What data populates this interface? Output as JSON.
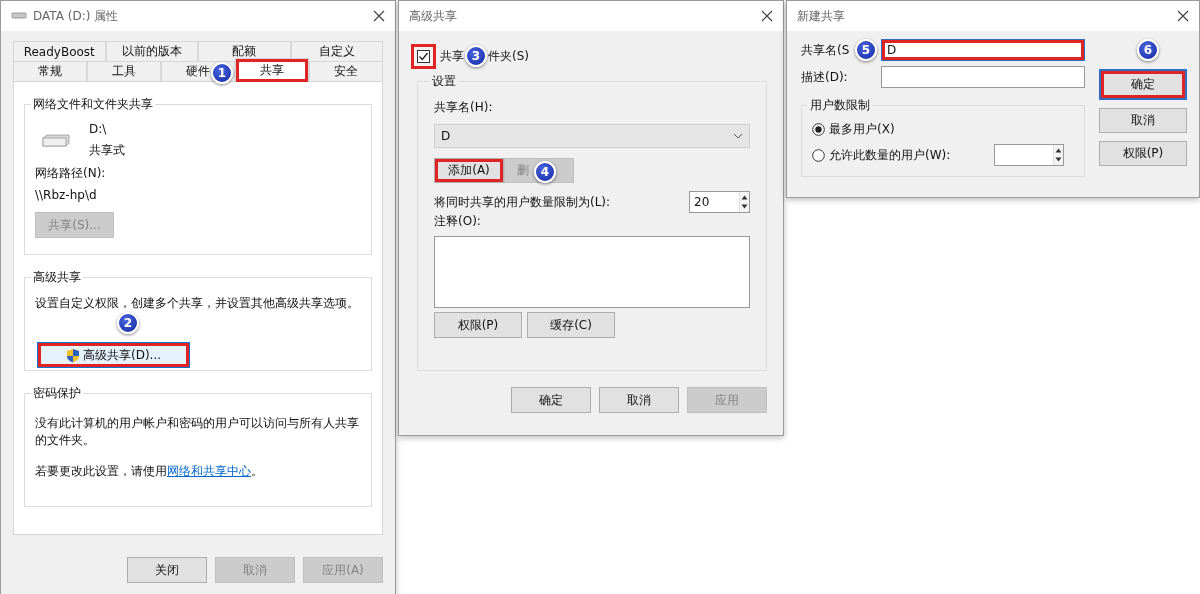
{
  "properties_window": {
    "title": "DATA (D:) 属性",
    "tab_rows": [
      [
        {
          "label": "ReadyBoost",
          "selected": false
        },
        {
          "label": "以前的版本",
          "selected": false
        },
        {
          "label": "配额",
          "selected": false
        },
        {
          "label": "自定义",
          "selected": false
        }
      ],
      [
        {
          "label": "常规",
          "selected": false
        },
        {
          "label": "工具",
          "selected": false
        },
        {
          "label": "硬件",
          "selected": false
        },
        {
          "label": "共享",
          "selected": true,
          "highlighted": true,
          "badge": "1"
        },
        {
          "label": "安全",
          "selected": false
        }
      ]
    ],
    "network_group": {
      "title": "网络文件和文件夹共享",
      "drive": "D:\\",
      "status": "共享式",
      "path_label": "网络路径(N):",
      "network_path": "\\\\Rbz-hp\\d",
      "share_button": {
        "label": "共享(S)...",
        "disabled": true
      }
    },
    "advanced_group": {
      "title": "高级共享",
      "description": "设置自定义权限，创建多个共享，并设置其他高级共享选项。",
      "button": {
        "label": "高级共享(D)...",
        "highlighted": true,
        "badge": "2"
      }
    },
    "password_group": {
      "title": "密码保护",
      "description": "没有此计算机的用户帐户和密码的用户可以访问与所有人共享的文件夹。",
      "hint": "若要更改此设置，请使用",
      "link": "网络和共享中心",
      "hint_end": "。"
    },
    "buttons": [
      {
        "label": "关闭",
        "disabled": false
      },
      {
        "label": "取消",
        "disabled": true
      },
      {
        "label": "应用(A)",
        "disabled": true
      }
    ]
  },
  "advanced_window": {
    "title": "高级共享",
    "share_checkbox": {
      "label_parts": [
        "共享",
        "件夹(S)"
      ],
      "checked": true,
      "highlighted": true,
      "badge": "3"
    },
    "settings_group": {
      "title": "设置",
      "share_name_label": "共享名(H):",
      "share_name": "D",
      "add_button": {
        "label": "添加(A)",
        "disabled": false,
        "highlighted": true
      },
      "remove_button": {
        "label": "删",
        "disabled": true,
        "badge": "4"
      },
      "limit_label": "将同时共享的用户数量限制为(L):",
      "limit_value": "20",
      "comment_label": "注释(O):",
      "buttons": [
        {
          "label": "权限(P)",
          "disabled": false
        },
        {
          "label": "缓存(C)",
          "disabled": false
        }
      ]
    },
    "buttons": [
      {
        "label": "确定",
        "disabled": false
      },
      {
        "label": "取消",
        "disabled": false
      },
      {
        "label": "应用",
        "disabled": true
      }
    ]
  },
  "new_share_window": {
    "title": "新建共享",
    "name_label": "共享名(S",
    "name_badge": "5",
    "name_value": "D",
    "name_focused": true,
    "name_highlighted": true,
    "description_label": "描述(D):",
    "limit_group": {
      "title": "用户数限制",
      "options": [
        {
          "label": "最多用户(X)",
          "selected": true
        },
        {
          "label": "允许此数量的用户(W):",
          "selected": false
        }
      ]
    },
    "buttons": [
      {
        "label": "确定",
        "default": true,
        "highlighted": true,
        "badge": "6"
      },
      {
        "label": "取消",
        "default": false
      },
      {
        "label": "权限(P)",
        "default": false
      }
    ]
  }
}
